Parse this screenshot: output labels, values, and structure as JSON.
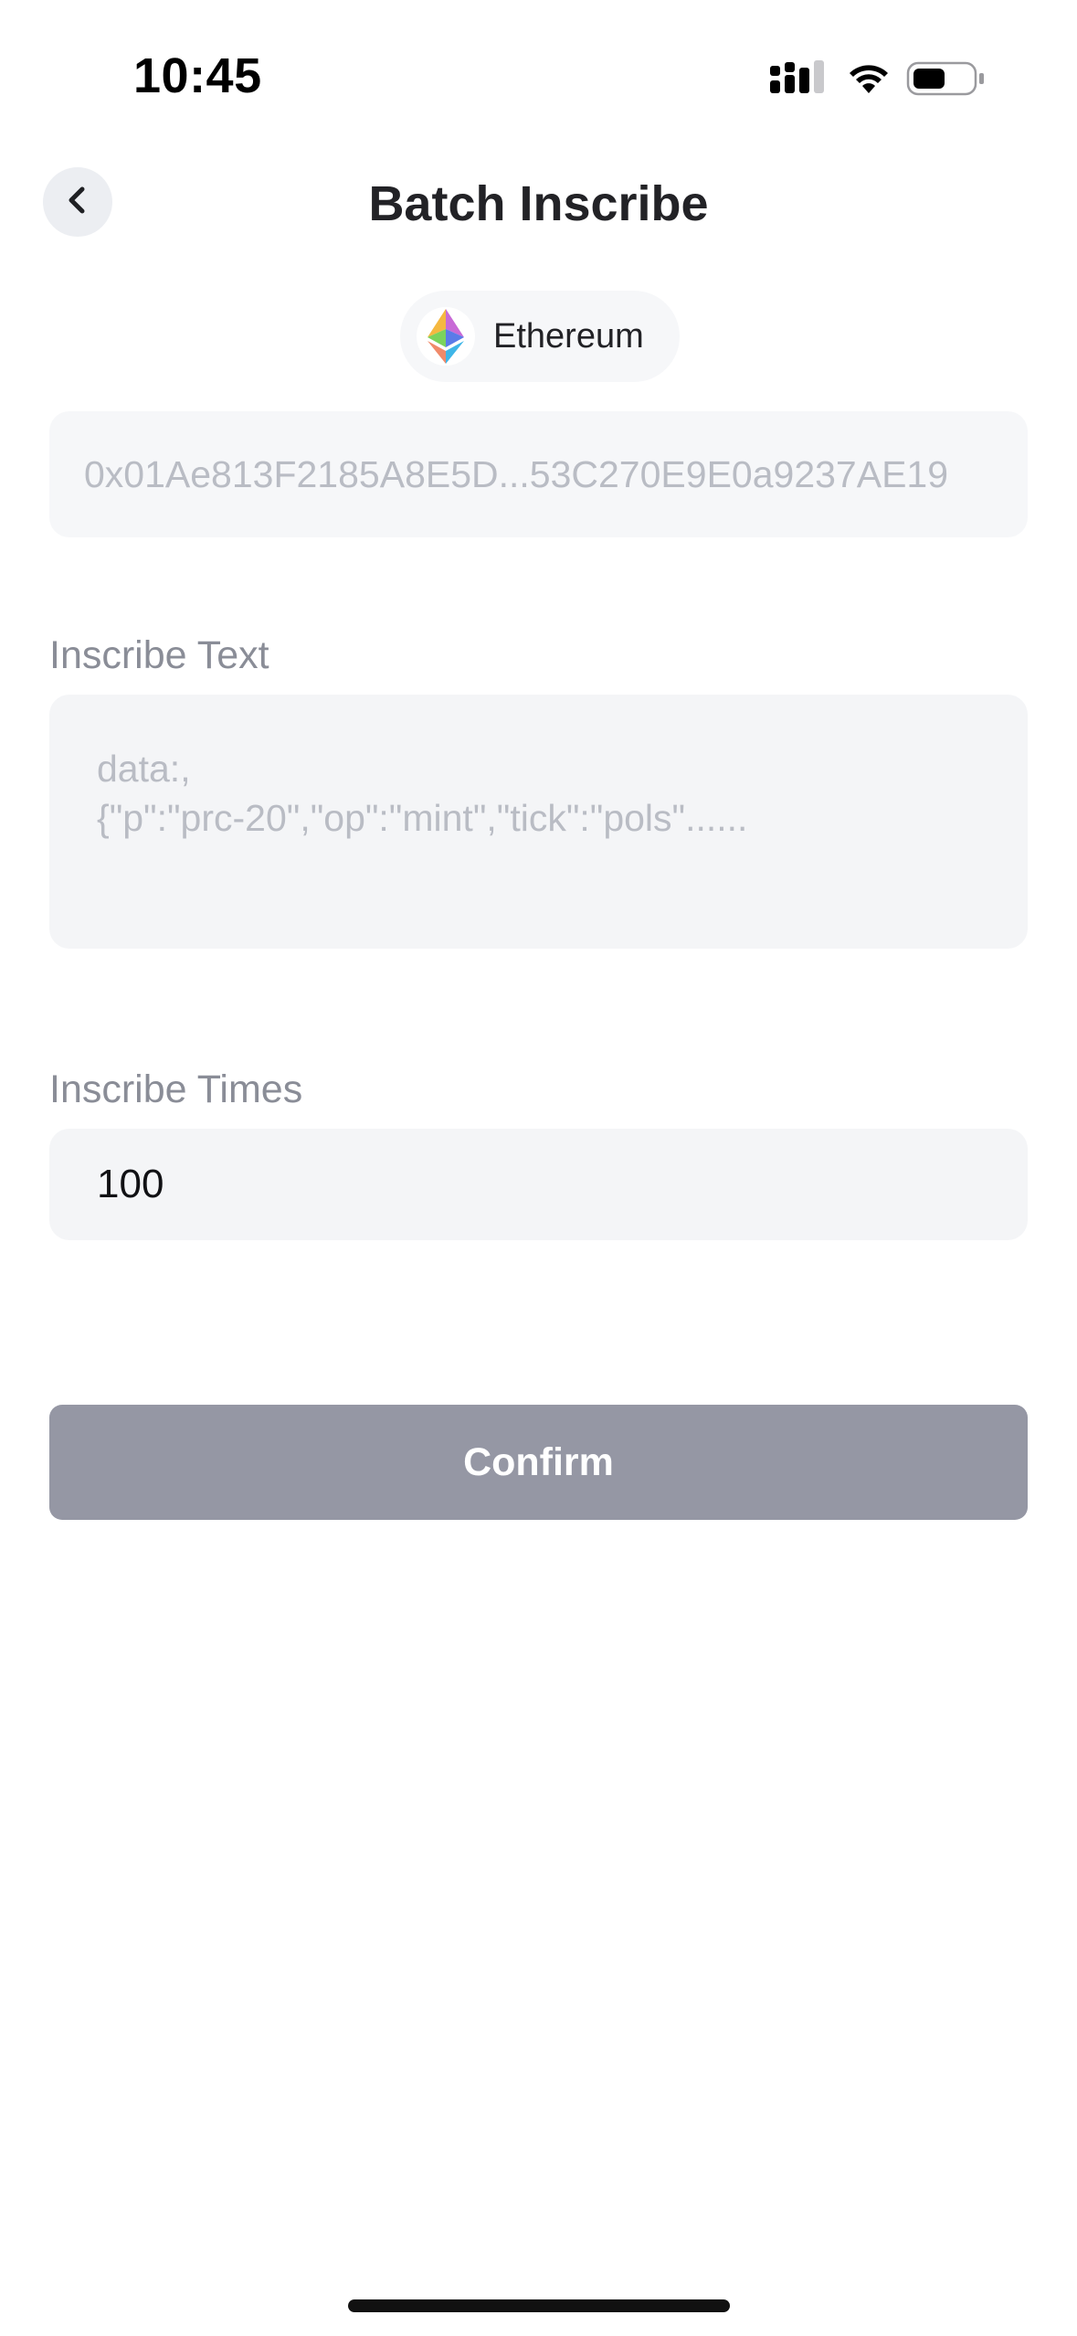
{
  "status_bar": {
    "time": "10:45",
    "icons": [
      "signal-icon",
      "wifi-icon",
      "battery-icon"
    ]
  },
  "header": {
    "title": "Batch Inscribe",
    "back_icon": "chevron-left-icon"
  },
  "network": {
    "name": "Ethereum",
    "logo": "ethereum-logo-icon"
  },
  "address": {
    "value": "0x01Ae813F2185A8E5D...53C270E9E0a9237AE19"
  },
  "inscribe_text": {
    "label": "Inscribe Text",
    "placeholder": "data:,\n{\"p\":\"prc-20\",\"op\":\"mint\",\"tick\":\"pols\"......"
  },
  "inscribe_times": {
    "label": "Inscribe Times",
    "value": "100"
  },
  "confirm": {
    "label": "Confirm"
  },
  "colors": {
    "button_disabled": "#9597a4",
    "field_background": "#f4f5f7",
    "label_text": "#8a8d97",
    "placeholder_text": "#b9bcc4"
  }
}
